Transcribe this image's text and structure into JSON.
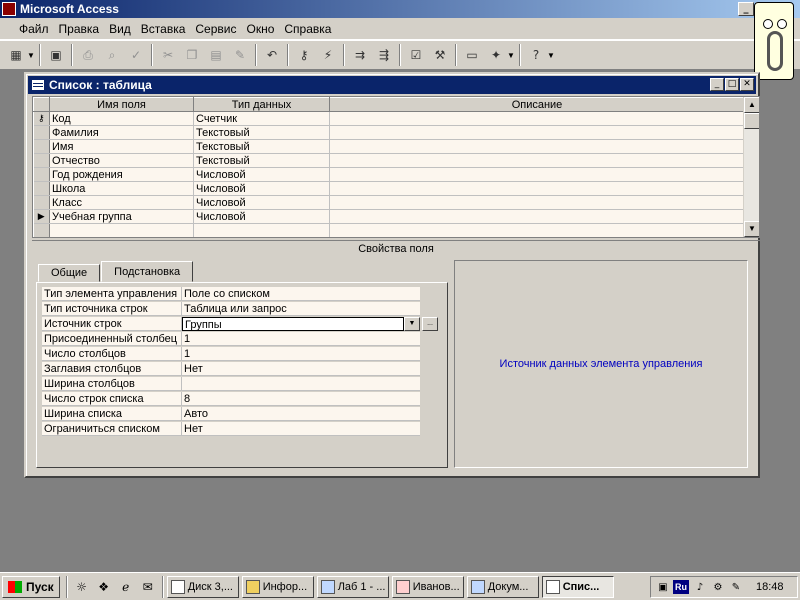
{
  "app": {
    "title": "Microsoft Access"
  },
  "menu": [
    "Файл",
    "Правка",
    "Вид",
    "Вставка",
    "Сервис",
    "Окно",
    "Справка"
  ],
  "window": {
    "title": "Список : таблица"
  },
  "grid": {
    "headers": [
      "Имя поля",
      "Тип данных",
      "Описание"
    ],
    "rows": [
      {
        "name": "Код",
        "type": "Счетчик"
      },
      {
        "name": "Фамилия",
        "type": "Текстовый"
      },
      {
        "name": "Имя",
        "type": "Текстовый"
      },
      {
        "name": "Отчество",
        "type": "Текстовый"
      },
      {
        "name": "Год рождения",
        "type": "Числовой"
      },
      {
        "name": "Школа",
        "type": "Числовой"
      },
      {
        "name": "Класс",
        "type": "Числовой"
      },
      {
        "name": "Учебная группа",
        "type": "Числовой"
      },
      {
        "name": "",
        "type": ""
      }
    ]
  },
  "properties": {
    "section_title": "Свойства поля",
    "tabs": [
      "Общие",
      "Подстановка"
    ],
    "active_tab": "Подстановка",
    "rows": [
      {
        "label": "Тип элемента управления",
        "value": "Поле со списком"
      },
      {
        "label": "Тип источника строк",
        "value": "Таблица или запрос"
      },
      {
        "label": "Источник строк",
        "value": "Группы"
      },
      {
        "label": "Присоединенный столбец",
        "value": "1"
      },
      {
        "label": "Число столбцов",
        "value": "1"
      },
      {
        "label": "Заглавия столбцов",
        "value": "Нет"
      },
      {
        "label": "Ширина столбцов",
        "value": ""
      },
      {
        "label": "Число строк списка",
        "value": "8"
      },
      {
        "label": "Ширина списка",
        "value": "Авто"
      },
      {
        "label": "Ограничиться списком",
        "value": "Нет"
      }
    ],
    "help_text": "Источник данных элемента управления"
  },
  "taskbar": {
    "start_label": "Пуск",
    "tasks": [
      "Диск 3,...",
      "Инфор...",
      "Лаб 1 - ...",
      "Иванов...",
      "Докум...",
      "Спис..."
    ],
    "active_task": "Спис...",
    "lang": "Ru",
    "time": "18:48"
  }
}
